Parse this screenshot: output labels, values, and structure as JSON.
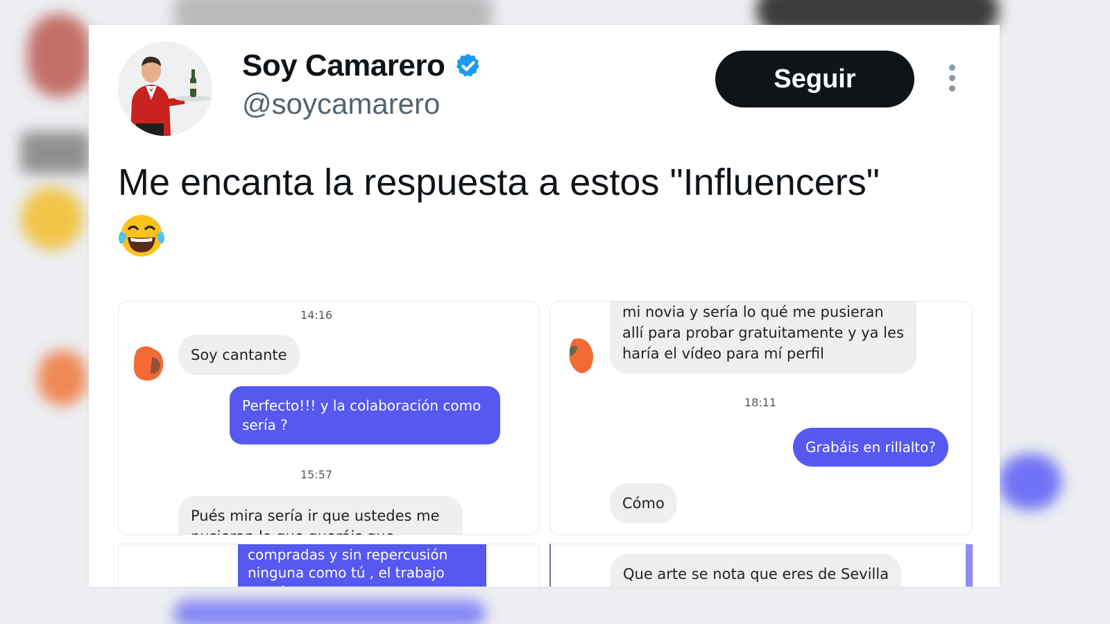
{
  "tweet": {
    "author_name": "Soy Camarero",
    "handle": "@soycamarero",
    "follow_label": "Seguir",
    "text": "Me encanta la respuesta a estos \"Influencers\"",
    "emoji": "😂"
  },
  "screenshots": {
    "left_top": {
      "time_1": "14:16",
      "msg_in_1": "Soy cantante",
      "msg_out_1": "Perfecto!!! y la colaboración como sería ?",
      "time_2": "15:57",
      "msg_in_2": "Pués mira sería ir que ustedes me pusieran lo que queráis que"
    },
    "right_top": {
      "msg_in_1": "mi novia y sería lo qué me pusieran allí para probar gratuitamente y ya les haría el vídeo para mí perfil",
      "time_1": "18:11",
      "msg_out_1": "Grabáis en rillalto?",
      "msg_in_2": "Cómo"
    },
    "left_bottom": {
      "msg_out": "compradas y sin repercusión ninguna como tú , el trabajo nuestro"
    },
    "right_bottom": {
      "msg_in": "Que arte se nota que eres de Sevilla"
    }
  },
  "colors": {
    "follow_bg": "#0f1419",
    "verified": "#1d9bf0",
    "handle": "#536471",
    "chat_out": "#5658f0",
    "chat_in": "#efefef"
  },
  "icons": [
    "verified-badge-icon",
    "more-options-icon",
    "laughing-crying-emoji"
  ]
}
